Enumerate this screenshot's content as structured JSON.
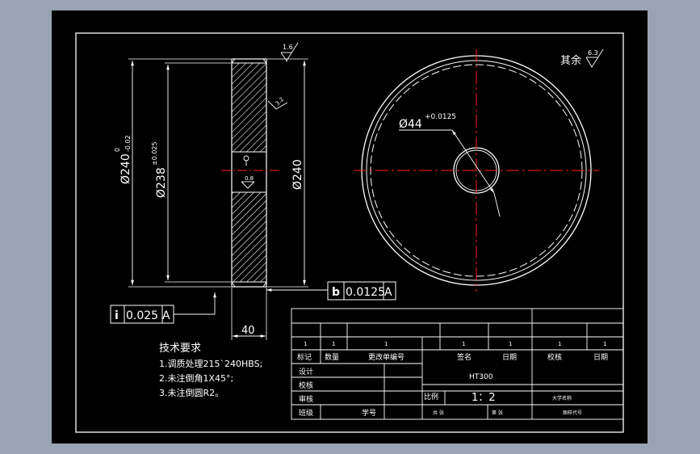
{
  "drawing": {
    "colors": {
      "background": "#000000",
      "sheet_border": "#ffffff",
      "center_line": "#ff2020",
      "frame": "#99a3b3"
    },
    "side_view": {
      "dims": {
        "outer_diameter": "Ø240",
        "outer_diameter_tol_upper": "0",
        "outer_diameter_tol_lower": "-0.02",
        "bore_diameter": "Ø238",
        "bore_tol": "±0.025",
        "right_diameter": "Ø240",
        "width": "40"
      },
      "surface_finish": {
        "top": "1.6",
        "face": "3.2",
        "hub": "0.8"
      },
      "tolerance_frames": {
        "circular_runout": {
          "symbol": "b",
          "value": "0.0125",
          "datum": "A"
        },
        "total_runout": {
          "symbol": "i",
          "value": "0.025",
          "datum": "A"
        }
      }
    },
    "front_view": {
      "bore_dim": "Ø44",
      "bore_tol": "+0.0125",
      "other_finish_label": "其余",
      "other_finish_value": "6.3"
    },
    "tech_requirements": {
      "title": "技术要求",
      "items": [
        "1.调质处理215`240HBS;",
        "2.未注倒角1X45°;",
        "3.未注倒圆R2。"
      ]
    },
    "title_block": {
      "tick_row": [
        "1",
        "1",
        "1",
        "1",
        "1",
        "1",
        "1"
      ],
      "header_row": [
        "标记",
        "数量",
        "更改单编号",
        "签名",
        "日期",
        "校核",
        "日期"
      ],
      "left_labels": [
        "设计",
        "校核",
        "审核",
        "班级"
      ],
      "student_id_label": "学号",
      "material": "HT300",
      "scale_label": "比例",
      "scale_value": "1：2",
      "total_label": "共  张",
      "sheet_label": "第  张",
      "school": "大学名称",
      "drawing_number": "图样代号"
    }
  }
}
